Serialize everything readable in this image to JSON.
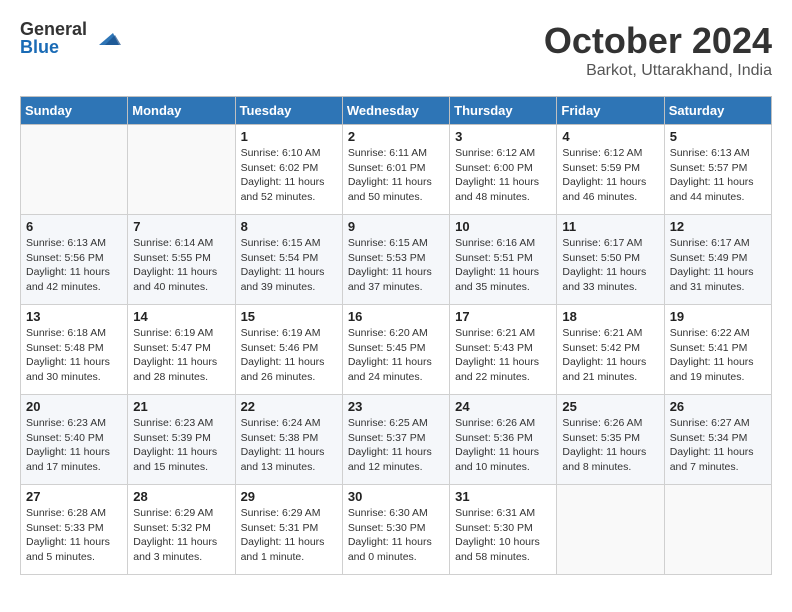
{
  "logo": {
    "general": "General",
    "blue": "Blue"
  },
  "header": {
    "month": "October 2024",
    "location": "Barkot, Uttarakhand, India"
  },
  "weekdays": [
    "Sunday",
    "Monday",
    "Tuesday",
    "Wednesday",
    "Thursday",
    "Friday",
    "Saturday"
  ],
  "weeks": [
    [
      null,
      null,
      {
        "day": 1,
        "sunrise": "6:10 AM",
        "sunset": "6:02 PM",
        "daylight": "11 hours and 52 minutes."
      },
      {
        "day": 2,
        "sunrise": "6:11 AM",
        "sunset": "6:01 PM",
        "daylight": "11 hours and 50 minutes."
      },
      {
        "day": 3,
        "sunrise": "6:12 AM",
        "sunset": "6:00 PM",
        "daylight": "11 hours and 48 minutes."
      },
      {
        "day": 4,
        "sunrise": "6:12 AM",
        "sunset": "5:59 PM",
        "daylight": "11 hours and 46 minutes."
      },
      {
        "day": 5,
        "sunrise": "6:13 AM",
        "sunset": "5:57 PM",
        "daylight": "11 hours and 44 minutes."
      }
    ],
    [
      {
        "day": 6,
        "sunrise": "6:13 AM",
        "sunset": "5:56 PM",
        "daylight": "11 hours and 42 minutes."
      },
      {
        "day": 7,
        "sunrise": "6:14 AM",
        "sunset": "5:55 PM",
        "daylight": "11 hours and 40 minutes."
      },
      {
        "day": 8,
        "sunrise": "6:15 AM",
        "sunset": "5:54 PM",
        "daylight": "11 hours and 39 minutes."
      },
      {
        "day": 9,
        "sunrise": "6:15 AM",
        "sunset": "5:53 PM",
        "daylight": "11 hours and 37 minutes."
      },
      {
        "day": 10,
        "sunrise": "6:16 AM",
        "sunset": "5:51 PM",
        "daylight": "11 hours and 35 minutes."
      },
      {
        "day": 11,
        "sunrise": "6:17 AM",
        "sunset": "5:50 PM",
        "daylight": "11 hours and 33 minutes."
      },
      {
        "day": 12,
        "sunrise": "6:17 AM",
        "sunset": "5:49 PM",
        "daylight": "11 hours and 31 minutes."
      }
    ],
    [
      {
        "day": 13,
        "sunrise": "6:18 AM",
        "sunset": "5:48 PM",
        "daylight": "11 hours and 30 minutes."
      },
      {
        "day": 14,
        "sunrise": "6:19 AM",
        "sunset": "5:47 PM",
        "daylight": "11 hours and 28 minutes."
      },
      {
        "day": 15,
        "sunrise": "6:19 AM",
        "sunset": "5:46 PM",
        "daylight": "11 hours and 26 minutes."
      },
      {
        "day": 16,
        "sunrise": "6:20 AM",
        "sunset": "5:45 PM",
        "daylight": "11 hours and 24 minutes."
      },
      {
        "day": 17,
        "sunrise": "6:21 AM",
        "sunset": "5:43 PM",
        "daylight": "11 hours and 22 minutes."
      },
      {
        "day": 18,
        "sunrise": "6:21 AM",
        "sunset": "5:42 PM",
        "daylight": "11 hours and 21 minutes."
      },
      {
        "day": 19,
        "sunrise": "6:22 AM",
        "sunset": "5:41 PM",
        "daylight": "11 hours and 19 minutes."
      }
    ],
    [
      {
        "day": 20,
        "sunrise": "6:23 AM",
        "sunset": "5:40 PM",
        "daylight": "11 hours and 17 minutes."
      },
      {
        "day": 21,
        "sunrise": "6:23 AM",
        "sunset": "5:39 PM",
        "daylight": "11 hours and 15 minutes."
      },
      {
        "day": 22,
        "sunrise": "6:24 AM",
        "sunset": "5:38 PM",
        "daylight": "11 hours and 13 minutes."
      },
      {
        "day": 23,
        "sunrise": "6:25 AM",
        "sunset": "5:37 PM",
        "daylight": "11 hours and 12 minutes."
      },
      {
        "day": 24,
        "sunrise": "6:26 AM",
        "sunset": "5:36 PM",
        "daylight": "11 hours and 10 minutes."
      },
      {
        "day": 25,
        "sunrise": "6:26 AM",
        "sunset": "5:35 PM",
        "daylight": "11 hours and 8 minutes."
      },
      {
        "day": 26,
        "sunrise": "6:27 AM",
        "sunset": "5:34 PM",
        "daylight": "11 hours and 7 minutes."
      }
    ],
    [
      {
        "day": 27,
        "sunrise": "6:28 AM",
        "sunset": "5:33 PM",
        "daylight": "11 hours and 5 minutes."
      },
      {
        "day": 28,
        "sunrise": "6:29 AM",
        "sunset": "5:32 PM",
        "daylight": "11 hours and 3 minutes."
      },
      {
        "day": 29,
        "sunrise": "6:29 AM",
        "sunset": "5:31 PM",
        "daylight": "11 hours and 1 minute."
      },
      {
        "day": 30,
        "sunrise": "6:30 AM",
        "sunset": "5:30 PM",
        "daylight": "11 hours and 0 minutes."
      },
      {
        "day": 31,
        "sunrise": "6:31 AM",
        "sunset": "5:30 PM",
        "daylight": "10 hours and 58 minutes."
      },
      null,
      null
    ]
  ]
}
